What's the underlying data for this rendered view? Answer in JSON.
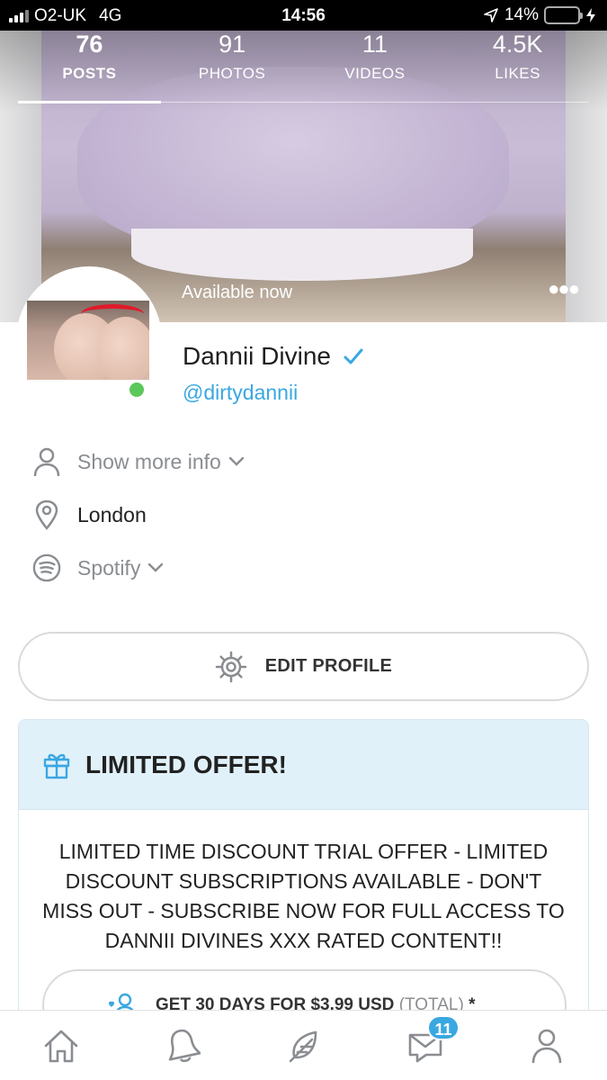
{
  "status_bar": {
    "carrier": "O2-UK",
    "network": "4G",
    "time": "14:56",
    "battery": "14%",
    "battery_level": 0.14
  },
  "stats": [
    {
      "value": "76",
      "label": "POSTS",
      "active": true
    },
    {
      "value": "91",
      "label": "PHOTOS"
    },
    {
      "value": "11",
      "label": "VIDEOS"
    },
    {
      "value": "4.5K",
      "label": "LIKES"
    }
  ],
  "header": {
    "availability": "Available now",
    "more_icon": "more-dots-icon"
  },
  "profile": {
    "name": "Dannii Divine",
    "handle": "@dirtydannii",
    "online": true,
    "verified": true
  },
  "info": {
    "more_info": "Show more info",
    "location": "London",
    "spotify": "Spotify"
  },
  "edit_profile": {
    "label": "EDIT PROFILE"
  },
  "offer": {
    "title": "LIMITED OFFER!",
    "text": "LIMITED TIME DISCOUNT TRIAL OFFER - LIMITED DISCOUNT SUBSCRIPTIONS AVAILABLE - DON'T MISS OUT - SUBSCRIBE NOW FOR FULL ACCESS TO DANNII DIVINES XXX RATED CONTENT!!",
    "subscribe_label": "GET 30 DAYS FOR $3.99 USD",
    "subscribe_total": "(TOTAL)",
    "subscribe_asterisk": "*"
  },
  "bottom_nav": {
    "messages_badge": "11",
    "items": [
      "home-icon",
      "bell-icon",
      "feather-icon",
      "messages-icon",
      "profile-icon"
    ]
  },
  "colors": {
    "accent": "#3aa7e1",
    "online": "#5bc85b",
    "offer_header_bg": "#e1f1fa"
  }
}
